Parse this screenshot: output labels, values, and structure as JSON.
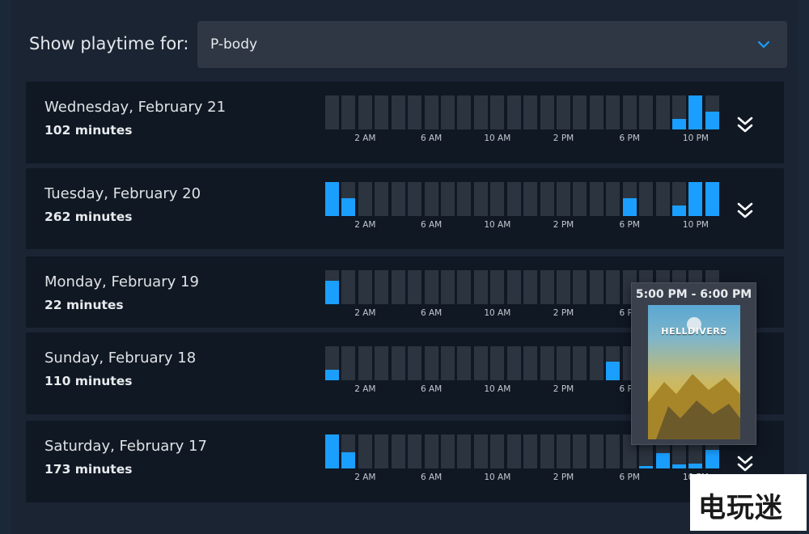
{
  "filter": {
    "label": "Show playtime for:",
    "selected": "P-body",
    "chevron_icon": "chevron-down-icon"
  },
  "tick_labels": [
    "2 AM",
    "6 AM",
    "10 AM",
    "2 PM",
    "6 PM",
    "10 PM"
  ],
  "days": [
    {
      "title": "Wednesday, February 21",
      "minutes": "102 minutes",
      "hourly_fraction": [
        0,
        0,
        0,
        0,
        0,
        0,
        0,
        0,
        0,
        0,
        0,
        0,
        0,
        0,
        0,
        0,
        0,
        0,
        0,
        0,
        0,
        0.32,
        1.0,
        0.52
      ]
    },
    {
      "title": "Tuesday, February 20",
      "minutes": "262 minutes",
      "hourly_fraction": [
        1.0,
        0.52,
        0,
        0,
        0,
        0,
        0,
        0,
        0,
        0,
        0,
        0,
        0,
        0,
        0,
        0,
        0,
        0,
        0.52,
        0,
        0,
        0.3,
        1.0,
        1.0
      ]
    },
    {
      "title": "Monday, February 19",
      "minutes": "22 minutes",
      "hourly_fraction": [
        0.7,
        0,
        0,
        0,
        0,
        0,
        0,
        0,
        0,
        0,
        0,
        0,
        0,
        0,
        0,
        0,
        0,
        0,
        0,
        0,
        0,
        0,
        0,
        0
      ]
    },
    {
      "title": "Sunday, February 18",
      "minutes": "110 minutes",
      "hourly_fraction": [
        0.3,
        0,
        0,
        0,
        0,
        0,
        0,
        0,
        0,
        0,
        0,
        0,
        0,
        0,
        0,
        0,
        0,
        0.55,
        0,
        0,
        0,
        0,
        0,
        0
      ]
    },
    {
      "title": "Saturday, February 17",
      "minutes": "173 minutes",
      "hourly_fraction": [
        1.0,
        0.48,
        0,
        0,
        0,
        0,
        0,
        0,
        0,
        0,
        0,
        0,
        0,
        0,
        0,
        0,
        0,
        0,
        0,
        0.08,
        0.45,
        0.12,
        0.15,
        0.55
      ]
    }
  ],
  "tooltip": {
    "time_range": "5:00 PM - 6:00 PM",
    "game_art_text": "HELLDIVERS"
  },
  "watermark": {
    "text": "电玩迷"
  },
  "colors": {
    "bar_active": "#1a9fff",
    "bar_empty": "#2c3440",
    "card_bg": "#101823",
    "page_bg": "#1b2433"
  },
  "icons": {
    "expand": "double-chevron-down-icon",
    "dropdown": "chevron-down-icon"
  }
}
